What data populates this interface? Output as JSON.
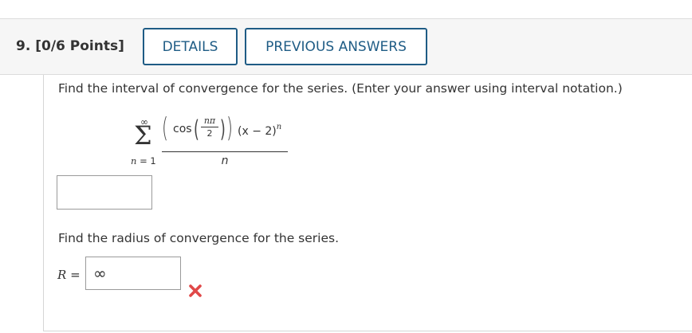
{
  "question": {
    "number": "9.",
    "points": "[0/6 Points]",
    "details_button": "DETAILS",
    "previous_answers_button": "PREVIOUS ANSWERS"
  },
  "prompt_interval": "Find the interval of convergence for the series. (Enter your answer using interval notation.)",
  "formula": {
    "sum_upper": "∞",
    "sum_lower_var": "n",
    "sum_lower_rest": " = 1",
    "cos": "cos",
    "inner_num": "nπ",
    "inner_den": "2",
    "tail": "(x − 2)",
    "exponent": "n",
    "denominator": "n"
  },
  "interval_answer": {
    "value": ""
  },
  "prompt_radius": "Find the radius of convergence for the series.",
  "radius": {
    "label_var": "R",
    "label_eq": " = ",
    "value": "∞",
    "status": "incorrect"
  },
  "colors": {
    "accent": "#1f5c85",
    "incorrect": "#e04848"
  }
}
